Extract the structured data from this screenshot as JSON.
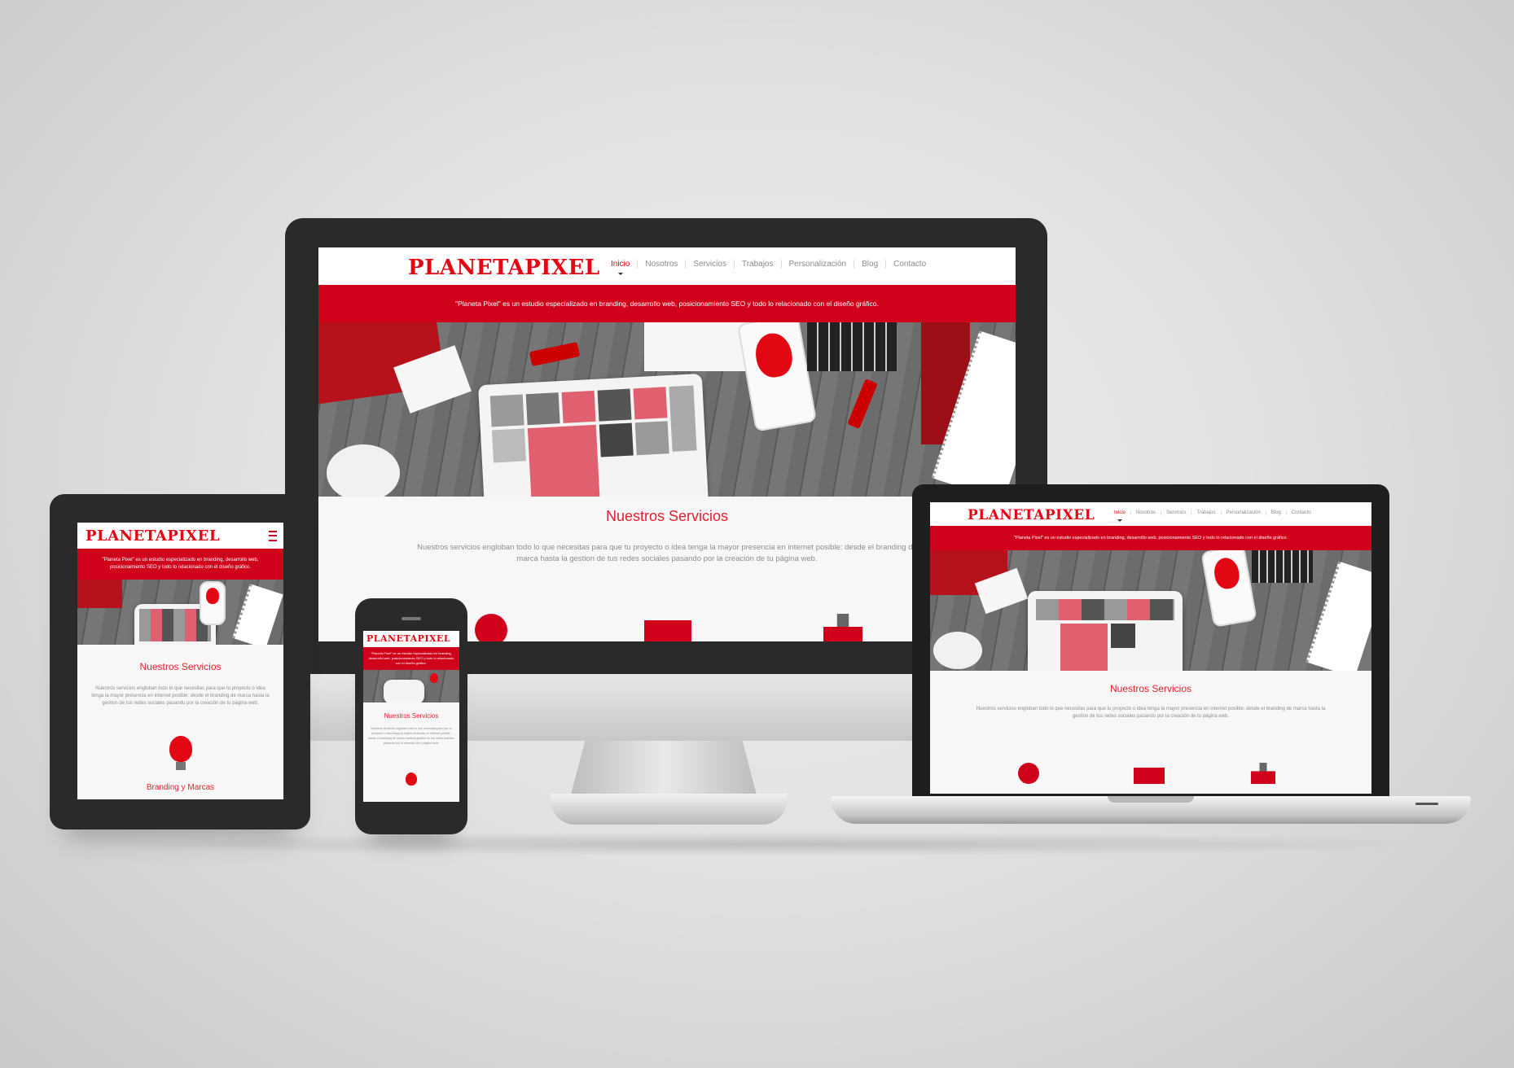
{
  "brand": {
    "logo_text": "PLANETAPIXEL",
    "accent": "#e30613"
  },
  "nav": {
    "items": [
      "Inicio",
      "Nosotros",
      "Servicios",
      "Trabajos",
      "Personalización",
      "Blog",
      "Contacto"
    ],
    "active": "Inicio"
  },
  "intro": {
    "text": "\"Planeta Pixel\" es un estudio especializado en branding, desarrollo web, posicionamiento SEO y todo lo relacionado con el diseño gráfico."
  },
  "services": {
    "title": "Nuestros Servicios",
    "text": "Nuestros servicios engloban todo lo que necesitas para que tu proyecto o idea tenga la mayor presencia en internet posible: desde el branding de marca hasta la gestion de tus redes sociales pasando por la creación de tu página web.",
    "first_service": "Branding y Marcas"
  },
  "menu_icon": "hamburger-icon"
}
